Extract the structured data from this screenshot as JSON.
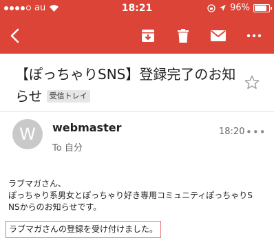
{
  "status_bar": {
    "carrier": "au",
    "time": "18:21",
    "battery_percent": "96%",
    "battery_level": 0.96,
    "signal_bars_filled": 4
  },
  "toolbar": {
    "back_icon": "chevron-left-icon",
    "archive_icon": "archive-icon",
    "delete_icon": "trash-icon",
    "mail_icon": "mail-icon",
    "more_icon": "more-horizontal-icon"
  },
  "email": {
    "subject": "【ぽっちゃりSNS】登録完了のお知らせ",
    "label": "受信トレイ",
    "sender_initial": "W",
    "sender_name": "webmaster",
    "to": "To 自分",
    "time": "18:20",
    "more_glyph": "•••",
    "body_line1": "ラブマガさん、",
    "body_line2": "ぽっちゃり系男女とぽっちゃり好き専用コミュニティぽっちゃりS",
    "body_line3": "NSからのお知らせです。",
    "highlight": "ラブマガさんの登録を受け付けました。"
  },
  "colors": {
    "accent": "#db4437",
    "highlight_border": "#e57373"
  }
}
